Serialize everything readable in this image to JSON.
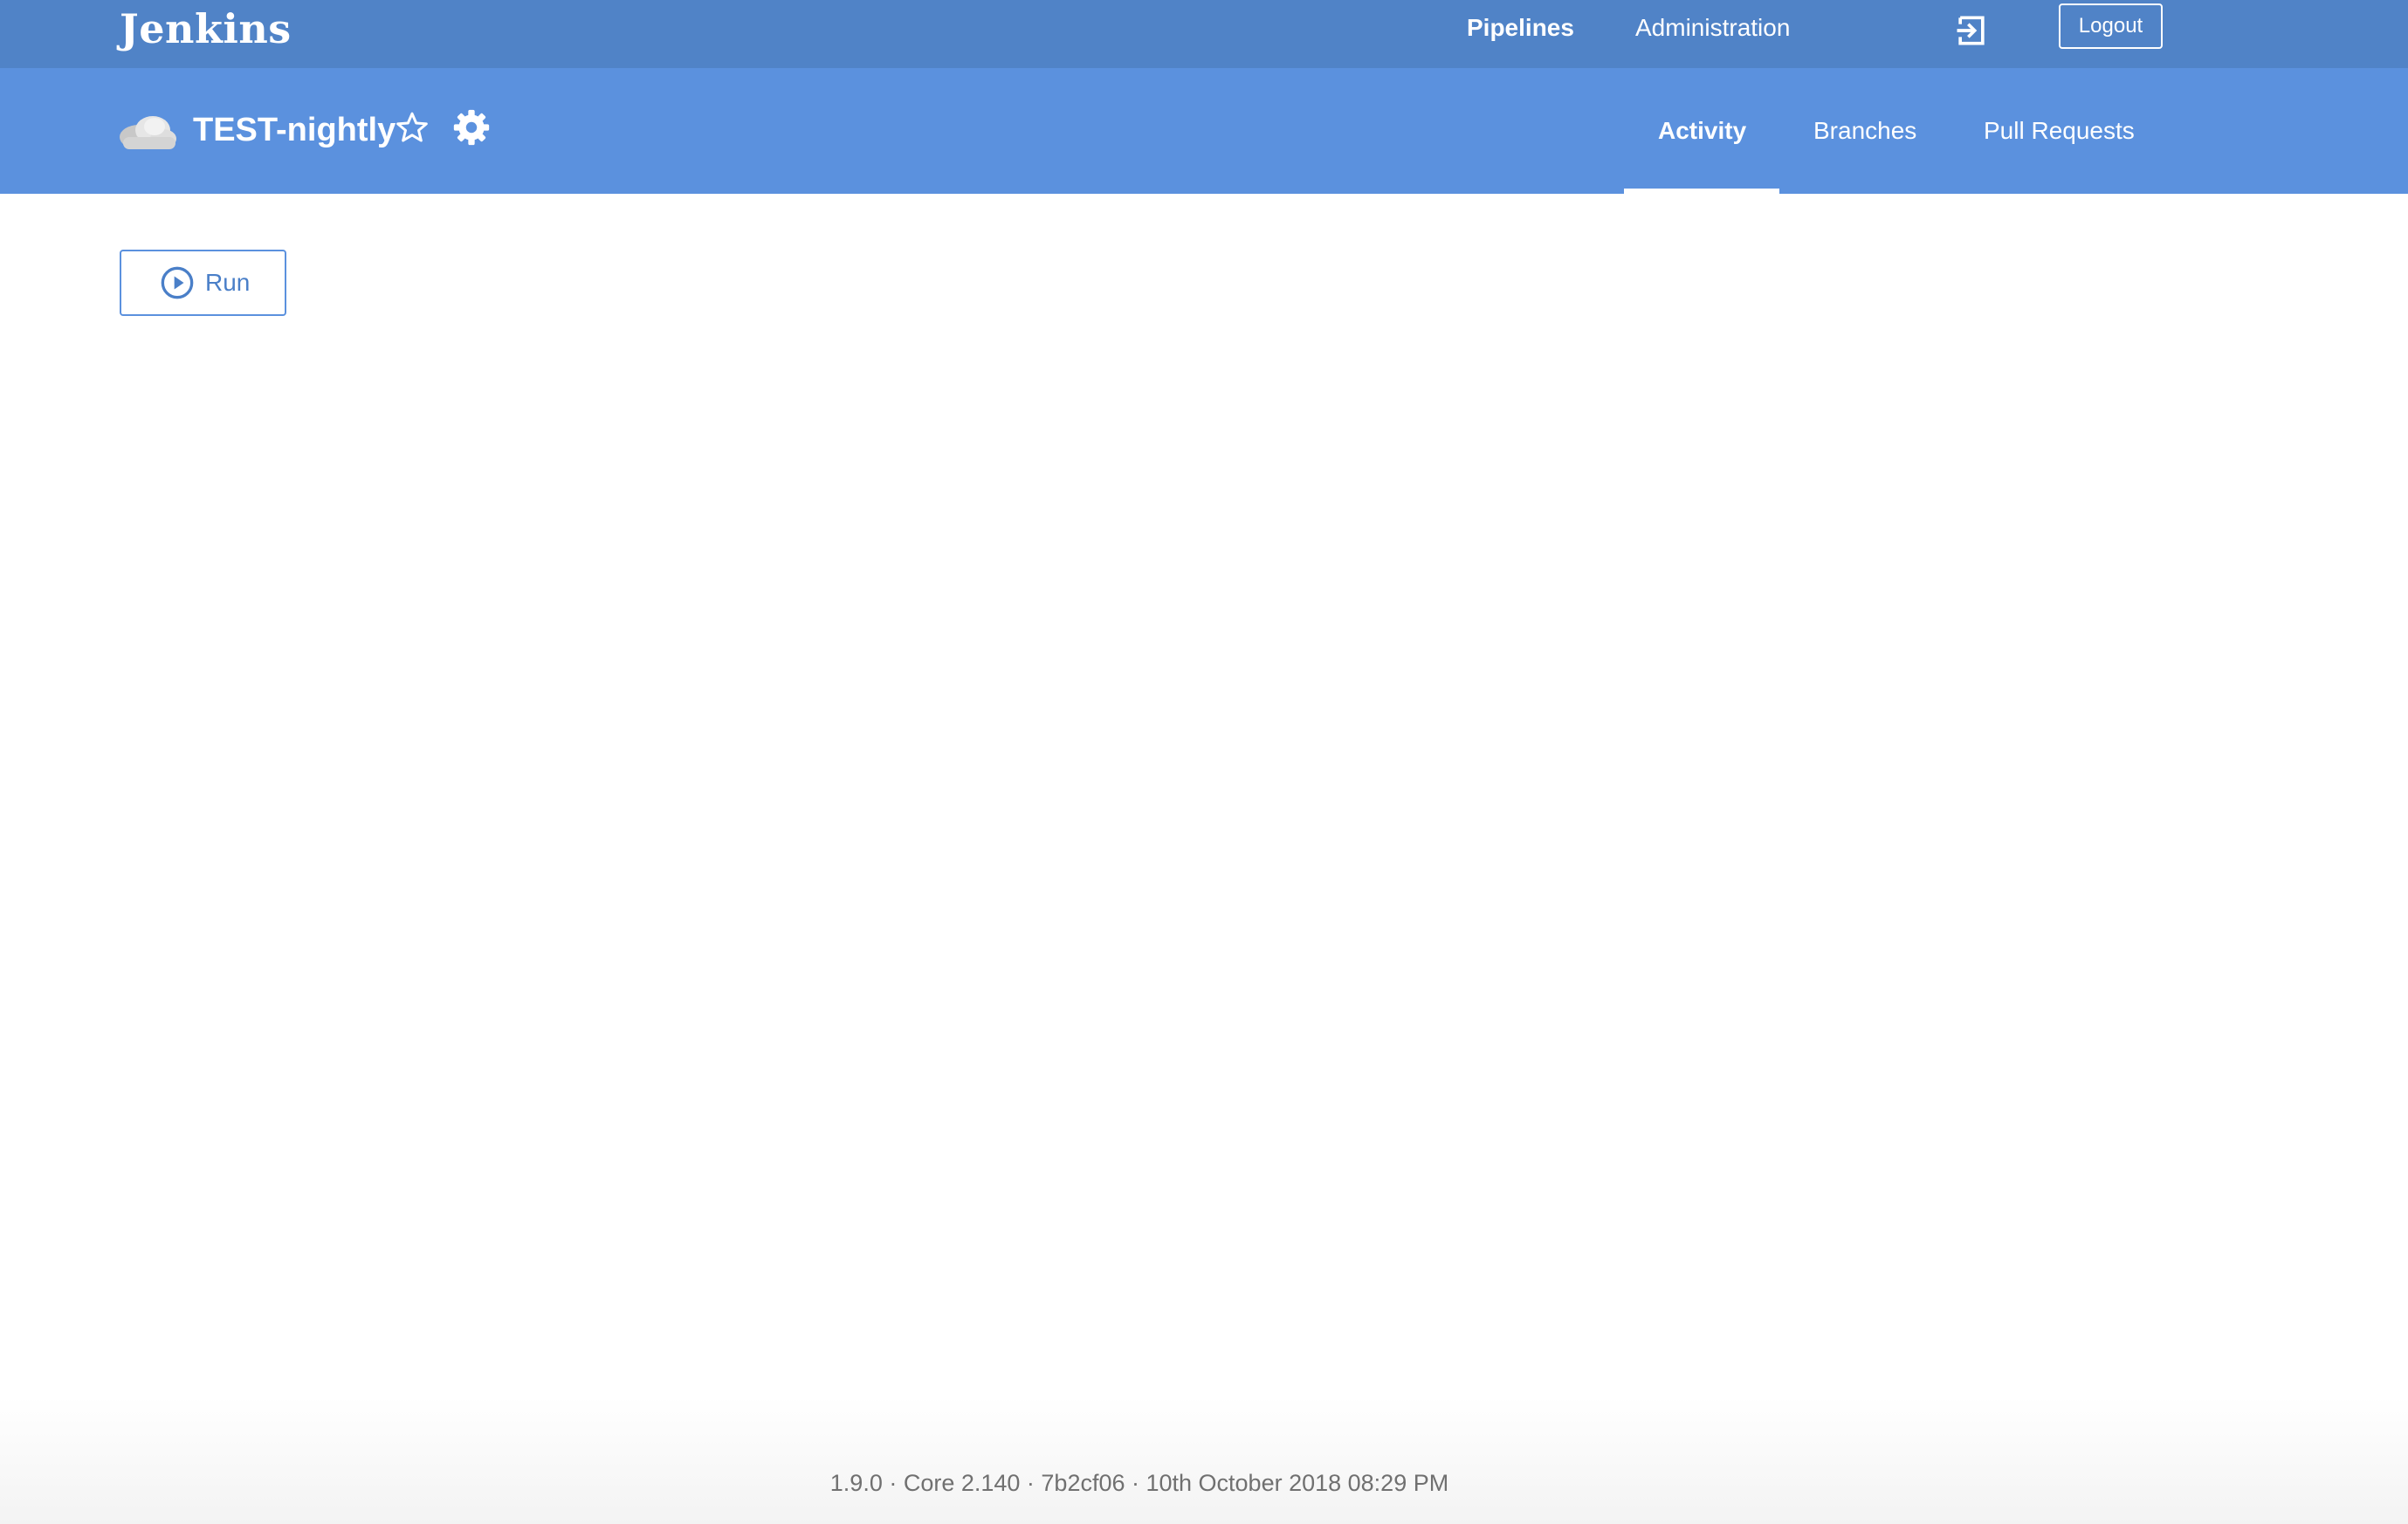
{
  "header": {
    "logo": "Jenkins",
    "nav": [
      {
        "label": "Pipelines",
        "active": true
      },
      {
        "label": "Administration",
        "active": false
      }
    ],
    "logout_label": "Logout"
  },
  "pipeline": {
    "name": "TEST-nightly",
    "tabs": [
      {
        "label": "Activity",
        "active": true
      },
      {
        "label": "Branches",
        "active": false
      },
      {
        "label": "Pull Requests",
        "active": false
      }
    ]
  },
  "main": {
    "run_label": "Run"
  },
  "footer": {
    "version_text": "1.9.0 · Core 2.140 · 7b2cf06 · 10th October 2018 08:29 PM"
  },
  "colors": {
    "topbar": "#5083c7",
    "subbar": "#5b91de",
    "accent": "#4a7fc8"
  },
  "icons": {
    "weather": "cloudy-weather-icon",
    "favorite": "star-icon",
    "settings": "gear-icon",
    "login": "login-icon",
    "run": "play-icon"
  }
}
